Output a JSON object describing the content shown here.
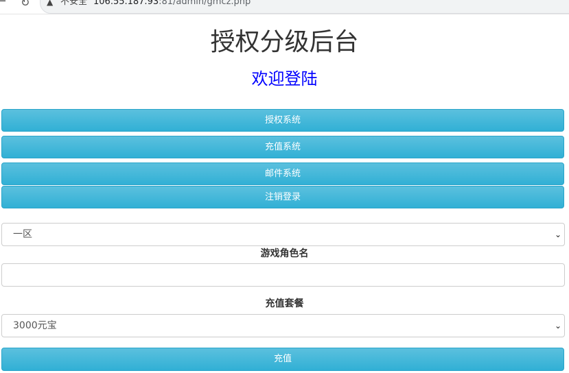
{
  "browser": {
    "back_glyph": "←",
    "reload_glyph": "↻",
    "warning_glyph": "▲",
    "security_label": "不安全",
    "url_host": "106.55.187.93",
    "url_rest": ":81/admin/gmcz.php"
  },
  "page": {
    "title": "授权分级后台",
    "subtitle": "欢迎登陆",
    "subtitle_color": "#0000ff"
  },
  "nav_buttons": [
    {
      "label": "授权系统"
    },
    {
      "label": "充值系统"
    },
    {
      "label": "邮件系统"
    },
    {
      "label": "注销登录"
    }
  ],
  "form": {
    "server_select": {
      "selected": "一区"
    },
    "role_label": "游戏角色名",
    "role_input": {
      "value": "",
      "placeholder": ""
    },
    "package_label": "充值套餐",
    "package_select": {
      "selected": "3000元宝"
    },
    "submit_label": "充值"
  },
  "icons": {
    "caret": "⌄"
  },
  "colors": {
    "button_top": "#5bc0de",
    "button_bottom": "#31b0d5",
    "button_border": "#28a4c9"
  }
}
